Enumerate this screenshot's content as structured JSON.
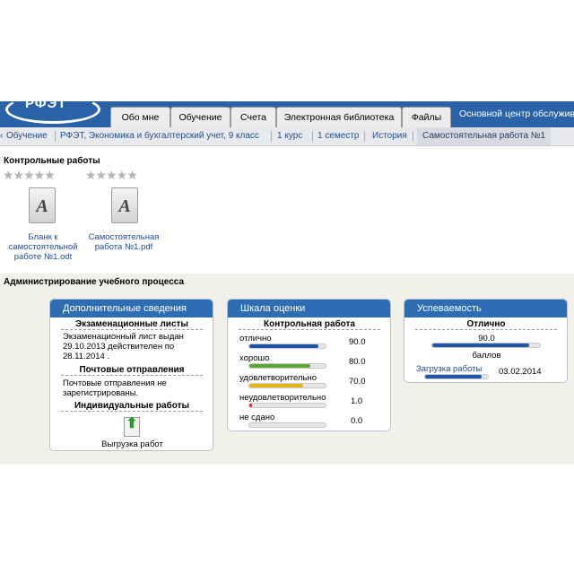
{
  "header": {
    "logo_text": "РФЭТ",
    "tabs": [
      "Обо мне",
      "Обучение",
      "Счета",
      "Электронная библиотека",
      "Файлы"
    ],
    "right_text": "Основной центр обслужива"
  },
  "breadcrumbs": [
    "Обучение",
    "РФЭТ, Экономика и бухгалтерский учет, 9 класс",
    "1 курс",
    "1 семестр",
    "История",
    "Самостоятельная работа №1"
  ],
  "control_works": {
    "title": "Контрольные работы",
    "files": [
      {
        "label_line1": "Бланк к",
        "label_line2": "самостоятельной",
        "label_line3": "работе №1.odt",
        "stars": "★★★★★"
      },
      {
        "label_line1": "Самостоятельная",
        "label_line2": "работа №1.pdf",
        "label_line3": "",
        "stars": "★★★★★"
      }
    ],
    "file_icon_letter": "A"
  },
  "admin": {
    "title": "Администрирование учебного процесса",
    "info_panel": {
      "header": "Дополнительные сведения",
      "exam_title": "Экзаменационные листы",
      "exam_text": [
        "Экзаменационный лист выдан",
        "29.10.2013 действителен по",
        "28.11.2014 ."
      ],
      "mail_title": "Почтовые отправления",
      "mail_text": [
        "Почтовые отправления не",
        "зарегистрированы."
      ],
      "works_title": "Индивидуальные работы",
      "upload_label": "Выгрузка работ"
    },
    "scale_panel": {
      "header": "Шкала оценки",
      "subtitle": "Контрольная работа",
      "rows": [
        {
          "label": "отлично",
          "value": "90.0",
          "fill": 0.9,
          "color": "#1f55a8"
        },
        {
          "label": "хорошо",
          "value": "80.0",
          "fill": 0.8,
          "color": "#5aa832"
        },
        {
          "label": "удовлетворительно",
          "value": "70.0",
          "fill": 0.7,
          "color": "#e7b416"
        },
        {
          "label": "неудовлетворительно",
          "value": "1.0",
          "fill": 0.01,
          "color": "#d42a2a"
        },
        {
          "label": "не сдано",
          "value": "0.0",
          "fill": 0,
          "color": "#999999"
        }
      ]
    },
    "progress_panel": {
      "header": "Успеваемость",
      "grade": "Отлично",
      "score": "90.0",
      "score_fill": 0.9,
      "unit": "баллов",
      "upload_label": "Загрузка работы",
      "upload_fill": 0.9,
      "date": "03.02.2014"
    }
  }
}
